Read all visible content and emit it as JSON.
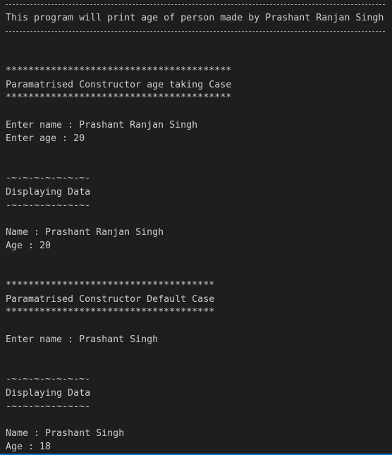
{
  "terminal": {
    "header_title": "This program will print age of person made by Prashant Ranjan Singh",
    "case1": {
      "stars": "****************************************",
      "title": "Paramatrised Constructor age taking Case",
      "prompt_name": "Enter name : Prashant Ranjan Singh",
      "prompt_age": "Enter age : 20",
      "divider": "-~-~-~-~-~-~-~-",
      "display_title": "Displaying Data",
      "output_name": "Name : Prashant Ranjan Singh",
      "output_age": "Age : 20"
    },
    "case2": {
      "stars": "*************************************",
      "title": "Paramatrised Constructor Default Case",
      "prompt_name": "Enter name : Prashant Singh",
      "divider": "-~-~-~-~-~-~-~-",
      "display_title": "Displaying Data",
      "output_name": "Name : Prashant Singh",
      "output_age": "Age : 18"
    }
  },
  "colors": {
    "background": "#1e1e1e",
    "text": "#cccccc",
    "accent_border": "#0e70c0"
  }
}
